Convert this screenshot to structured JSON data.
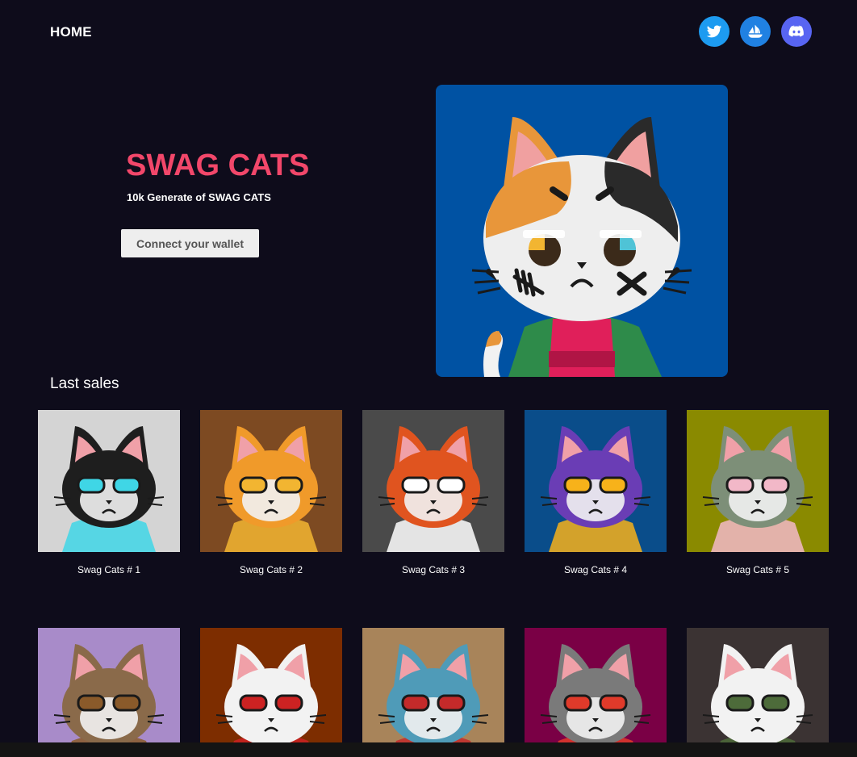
{
  "nav": {
    "home_label": "HOME"
  },
  "socials": [
    {
      "icon": "twitter-icon",
      "color": "#1d9bf0"
    },
    {
      "icon": "opensea-icon",
      "color": "#2081e2"
    },
    {
      "icon": "discord-icon",
      "color": "#5865f2"
    }
  ],
  "hero": {
    "title": "SWAG CATS",
    "title_color": "#f2476a",
    "subtitle": "10k Generate of SWAG CATS",
    "connect_label": "Connect your wallet",
    "image_bg": "#0052a3"
  },
  "last_sales": {
    "title": "Last sales",
    "items": [
      {
        "name": "Swag Cats # 1",
        "bg": "#d4d4d4",
        "fur": "#1e1e1e",
        "accent": "#3fd6e6"
      },
      {
        "name": "Swag Cats # 2",
        "bg": "#7d4a22",
        "fur": "#f09a2a",
        "accent": "#f2b531"
      },
      {
        "name": "Swag Cats # 3",
        "bg": "#4a4a4a",
        "fur": "#e0541f",
        "accent": "#ffffff"
      },
      {
        "name": "Swag Cats # 4",
        "bg": "#0a4d8a",
        "fur": "#6a3db5",
        "accent": "#f7b21a"
      },
      {
        "name": "Swag Cats # 5",
        "bg": "#8a8a00",
        "fur": "#7d8f78",
        "accent": "#f2b8c8"
      },
      {
        "name": "",
        "bg": "#a88bc9",
        "fur": "#8a6a4a",
        "accent": "#8a5a2a"
      },
      {
        "name": "",
        "bg": "#7d2d00",
        "fur": "#f2f2f2",
        "accent": "#cc2222"
      },
      {
        "name": "",
        "bg": "#a8845a",
        "fur": "#4f9bb8",
        "accent": "#c42a2a"
      },
      {
        "name": "",
        "bg": "#7a0045",
        "fur": "#7a7a7a",
        "accent": "#e03a2a"
      },
      {
        "name": "",
        "bg": "#3b3333",
        "fur": "#f2f2f2",
        "accent": "#4d6b3a"
      }
    ]
  }
}
